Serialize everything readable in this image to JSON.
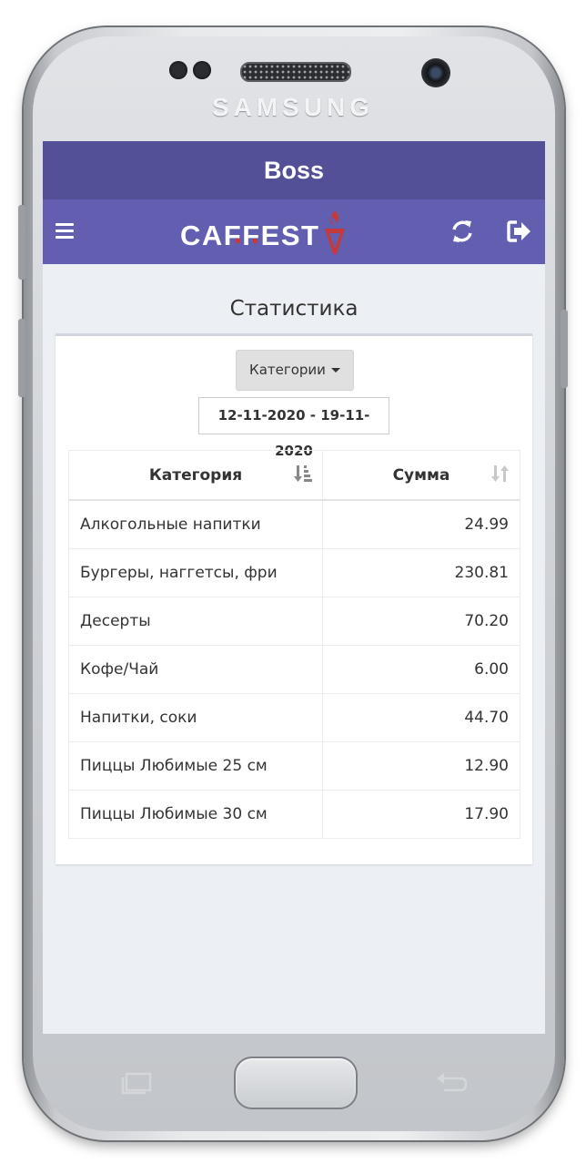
{
  "device": {
    "brand": "SAMSUNG"
  },
  "app": {
    "title": "Boss",
    "logo": {
      "part1": "CAFFEST",
      "accent_color": "#c43a3a"
    },
    "colors": {
      "titlebar": "#535098",
      "navbar": "#625fb0"
    }
  },
  "navbar": {
    "left_icon": "hamburger-menu-icon",
    "right_icons": [
      "refresh-icon",
      "sign-out-icon"
    ]
  },
  "page": {
    "heading": "Статистика",
    "filter": {
      "label": "Категории",
      "date_range": "12-11-2020 - 19-11-2020"
    },
    "table": {
      "columns": [
        {
          "label": "Категория",
          "sort_icon": "sort-amount-desc-icon"
        },
        {
          "label": "Сумма",
          "sort_icon": "sort-icon"
        }
      ],
      "rows": [
        {
          "category": "Алкогольные напитки",
          "sum": "24.99"
        },
        {
          "category": "Бургеры, наггетсы, фри",
          "sum": "230.81"
        },
        {
          "category": "Десерты",
          "sum": "70.20"
        },
        {
          "category": "Кофе/Чай",
          "sum": "6.00"
        },
        {
          "category": "Напитки, соки",
          "sum": "44.70"
        },
        {
          "category": "Пиццы Любимые 25 см",
          "sum": "12.90"
        },
        {
          "category": "Пиццы Любимые 30 см",
          "sum": "17.90"
        }
      ]
    }
  }
}
